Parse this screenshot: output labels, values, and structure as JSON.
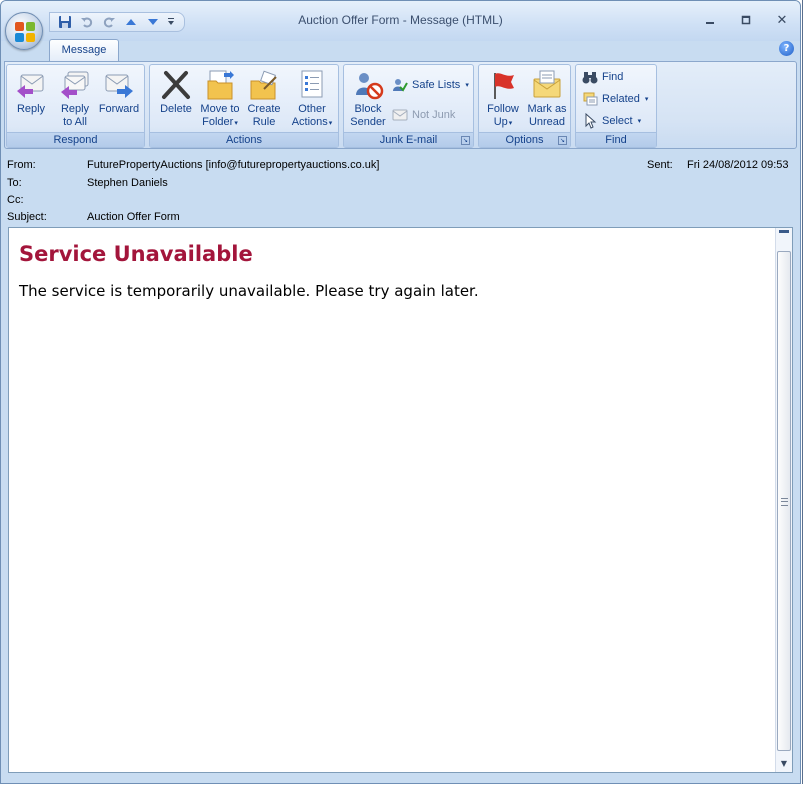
{
  "window": {
    "title": "Auction Offer Form - Message (HTML)",
    "minimize_icon": "minimize-icon",
    "maximize_icon": "maximize-icon",
    "close_symbol": "✕"
  },
  "quick_access": {
    "items": [
      "save-icon",
      "undo-icon",
      "redo-icon",
      "previous-item-icon",
      "next-item-icon",
      "customize-dropdown-icon"
    ]
  },
  "tabs": [
    {
      "label": "Message",
      "active": true
    }
  ],
  "help_symbol": "?",
  "ribbon": {
    "respond": {
      "label": "Respond",
      "reply": [
        "Reply",
        ""
      ],
      "reply_all": [
        "Reply",
        "to All"
      ],
      "forward": [
        "Forward",
        ""
      ]
    },
    "actions": {
      "label": "Actions",
      "delete": [
        "Delete",
        ""
      ],
      "move_to_folder": [
        "Move to",
        "Folder"
      ],
      "create_rule": [
        "Create",
        "Rule"
      ],
      "other_actions": [
        "Other",
        "Actions"
      ]
    },
    "junk": {
      "label": "Junk E-mail",
      "block_sender": [
        "Block",
        "Sender"
      ],
      "safe_lists": "Safe Lists",
      "not_junk": "Not Junk"
    },
    "options": {
      "label": "Options",
      "follow_up": [
        "Follow",
        "Up"
      ],
      "mark_unread": [
        "Mark as",
        "Unread"
      ]
    },
    "find": {
      "label": "Find",
      "find": "Find",
      "related": "Related",
      "select": "Select"
    }
  },
  "header": {
    "from_label": "From:",
    "from_value": "FuturePropertyAuctions [info@futurepropertyauctions.co.uk]",
    "to_label": "To:",
    "to_value": "Stephen Daniels",
    "cc_label": "Cc:",
    "cc_value": "",
    "subject_label": "Subject:",
    "subject_value": "Auction Offer Form",
    "sent_label": "Sent:",
    "sent_value": "Fri 24/08/2012 09:53"
  },
  "body": {
    "heading": "Service Unavailable",
    "text": "The service is temporarily unavailable. Please try again later."
  },
  "colors": {
    "heading": "#a3153b",
    "ribbon_text": "#15428b",
    "frame": "#c8dcf1"
  }
}
